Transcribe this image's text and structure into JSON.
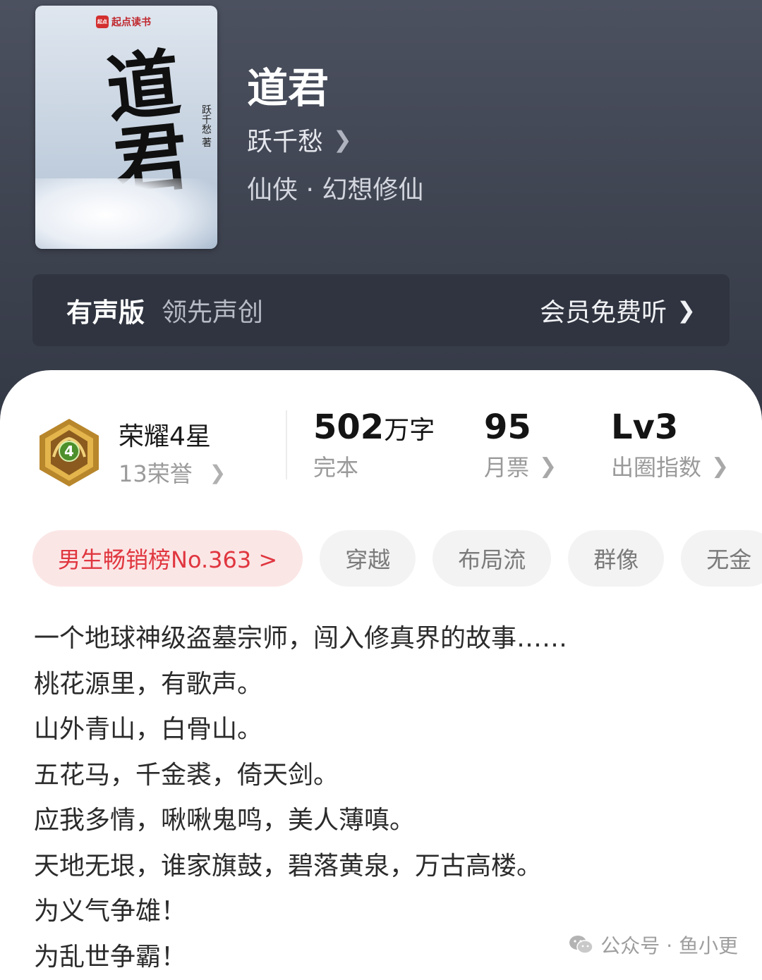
{
  "cover": {
    "publisher": "起点读书",
    "big_char": "道君",
    "author_vertical": "跃千愁 著"
  },
  "book": {
    "title": "道君",
    "author": "跃千愁",
    "genre": "仙侠 · 幻想修仙"
  },
  "audio": {
    "title": "有声版",
    "subtitle": "领先声创",
    "action": "会员免费听"
  },
  "honor": {
    "level_number": "4",
    "title": "荣耀4星",
    "count": "13荣誉"
  },
  "stats": {
    "words_value": "502",
    "words_unit": "万字",
    "words_label": "完本",
    "tickets_value": "95",
    "tickets_label": "月票",
    "index_value": "Lv3",
    "index_label": "出圈指数"
  },
  "tags": {
    "rank": "男生畅销榜No.363 >",
    "items": [
      "穿越",
      "布局流",
      "群像",
      "无金"
    ]
  },
  "description": [
    "一个地球神级盗墓宗师，闯入修真界的故事……",
    "桃花源里，有歌声。",
    "山外青山，白骨山。",
    "五花马，千金裘，倚天剑。",
    "应我多情，啾啾鬼鸣，美人薄嗔。",
    "天地无垠，谁家旗鼓，碧落黄泉，万古高楼。",
    "为义气争雄！",
    "为乱世争霸！"
  ],
  "watermark": {
    "text": "公众号 · 鱼小更"
  },
  "colors": {
    "rank_red": "#e0363f",
    "badge_gold": "#c99a35",
    "badge_green": "#4c8f2c"
  }
}
